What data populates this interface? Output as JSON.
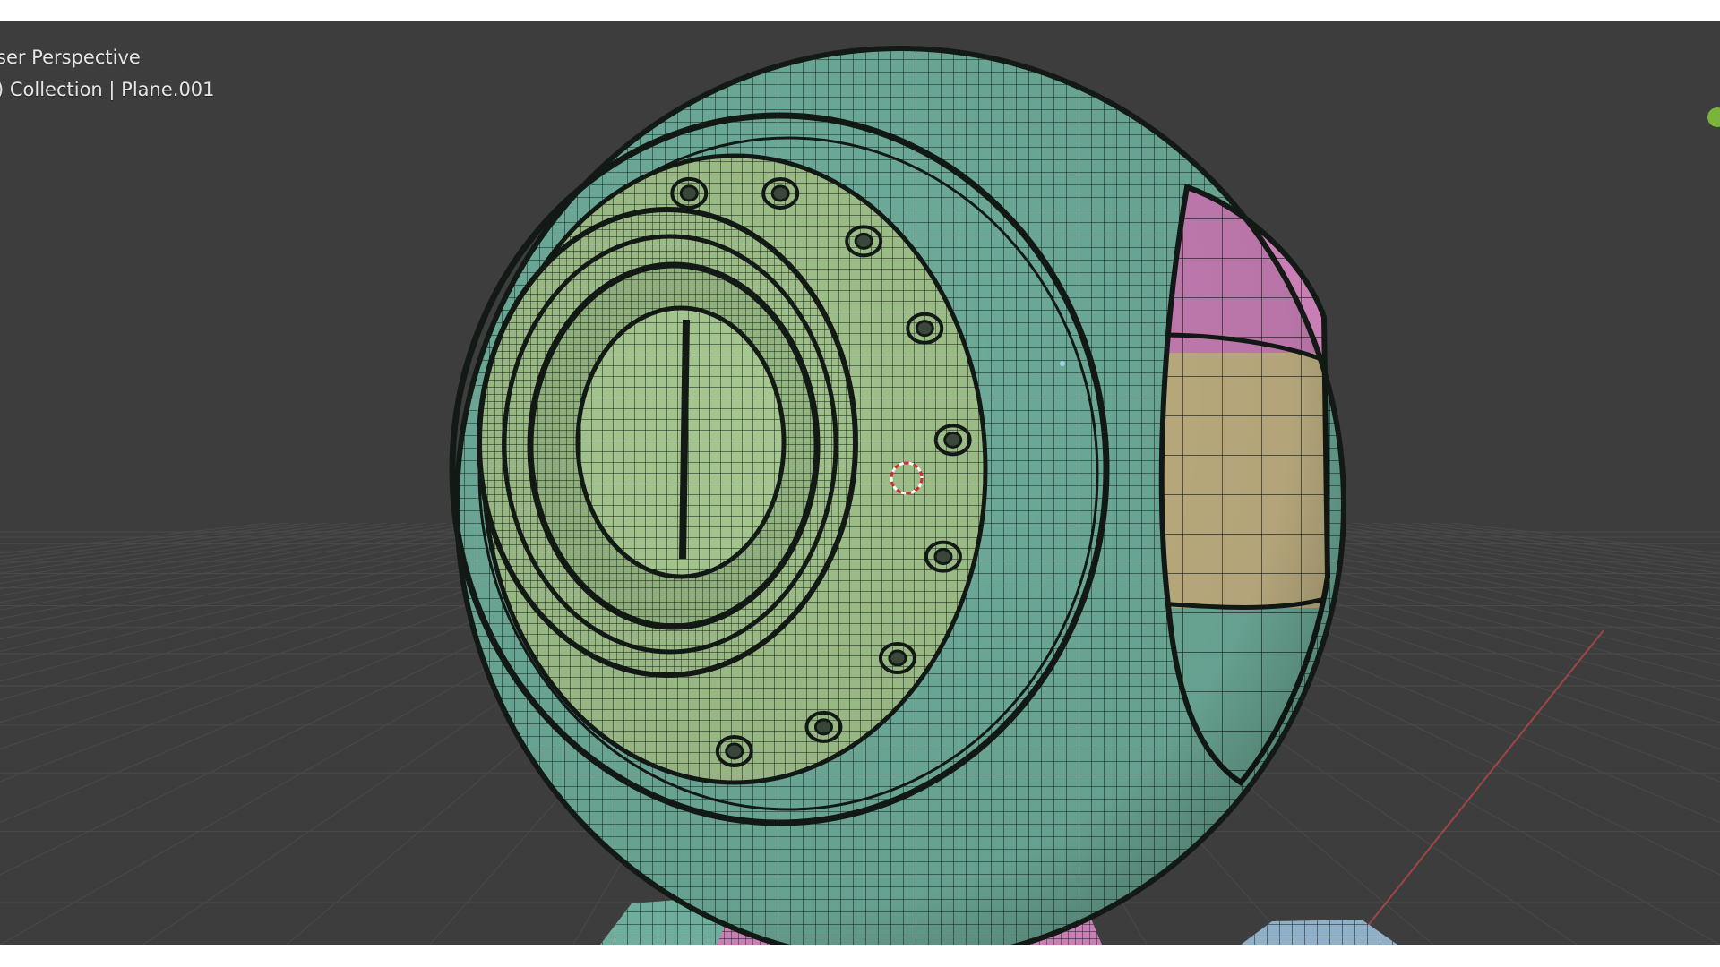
{
  "viewport": {
    "view_name": "ser Perspective",
    "object_info": ") Collection | Plane.001"
  },
  "colors": {
    "background": "#3d3d3d",
    "grid_line": "#4a4a4a",
    "wire": "#131a16",
    "teal_shell": "#6fae9c",
    "green_face": "#9fc08a",
    "pink_panel": "#c97fb6",
    "tan_panel": "#c2b283",
    "x_axis": "#b84848",
    "gizmo_green": "#7bb43a",
    "cursor_red": "#d42a2a"
  },
  "icons": {
    "cursor": "3d-cursor-icon",
    "axis_dot": "axis-gizmo-y-icon"
  }
}
